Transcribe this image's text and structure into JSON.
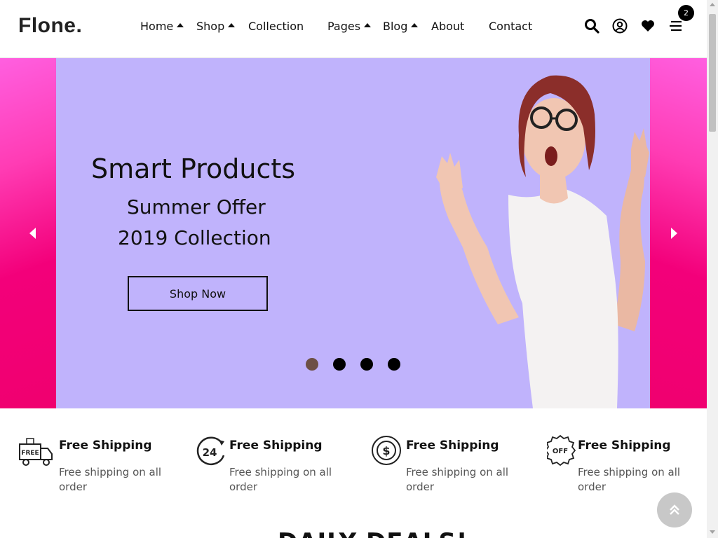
{
  "header": {
    "logo": "Flone.",
    "nav": [
      {
        "label": "Home",
        "has_dropdown": true
      },
      {
        "label": "Shop",
        "has_dropdown": true
      },
      {
        "label": "Collection",
        "has_dropdown": false
      },
      {
        "label": "Pages",
        "has_dropdown": true
      },
      {
        "label": "Blog",
        "has_dropdown": true
      },
      {
        "label": "About",
        "has_dropdown": false
      },
      {
        "label": "Contact",
        "has_dropdown": false
      }
    ],
    "icons": [
      "search-icon",
      "user-icon",
      "heart-icon",
      "cart-menu-icon"
    ],
    "cart_count": "2"
  },
  "hero": {
    "title": "Smart Products",
    "subtitle_1": "Summer Offer",
    "subtitle_2": "2019 Collection",
    "button_label": "Shop Now",
    "slide_count": 4,
    "active_slide": 1,
    "bg_color": "#c0b3fc",
    "accent_color": "#f3007a"
  },
  "features": [
    {
      "icon": "free-delivery-truck-icon",
      "title": "Free Shipping",
      "desc": "Free shipping on all order"
    },
    {
      "icon": "24-hour-support-icon",
      "title": "Free Shipping",
      "desc": "Free shipping on all order"
    },
    {
      "icon": "money-back-icon",
      "title": "Free Shipping",
      "desc": "Free shipping on all order"
    },
    {
      "icon": "discount-off-badge-icon",
      "title": "Free Shipping",
      "desc": "Free shipping on all order"
    }
  ],
  "section_heading": "DAILY DEALS!"
}
